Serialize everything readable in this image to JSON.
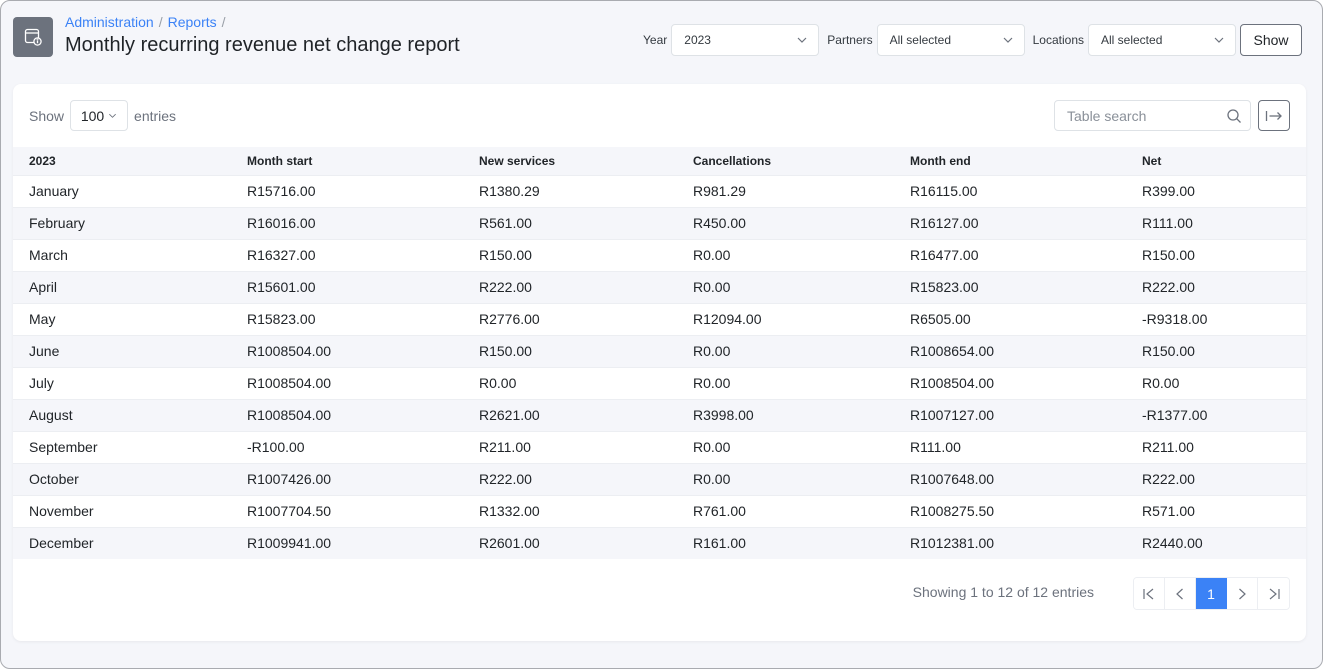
{
  "header": {
    "icon": "report-info-icon",
    "breadcrumb": [
      {
        "label": "Administration"
      },
      {
        "label": "Reports"
      }
    ],
    "separator": "/",
    "title": "Monthly recurring revenue net change report"
  },
  "filters": {
    "year": {
      "label": "Year",
      "value": "2023"
    },
    "partners": {
      "label": "Partners",
      "value": "All selected"
    },
    "locations": {
      "label": "Locations",
      "value": "All selected"
    },
    "show_button": "Show"
  },
  "table_controls": {
    "length_prefix": "Show",
    "length_value": "100",
    "length_suffix": "entries",
    "search_placeholder": "Table search",
    "export_icon": "export-arrow-icon"
  },
  "table": {
    "columns": [
      "2023",
      "Month start",
      "New services",
      "Cancellations",
      "Month end",
      "Net"
    ],
    "rows": [
      [
        "January",
        "R15716.00",
        "R1380.29",
        "R981.29",
        "R16115.00",
        "R399.00"
      ],
      [
        "February",
        "R16016.00",
        "R561.00",
        "R450.00",
        "R16127.00",
        "R111.00"
      ],
      [
        "March",
        "R16327.00",
        "R150.00",
        "R0.00",
        "R16477.00",
        "R150.00"
      ],
      [
        "April",
        "R15601.00",
        "R222.00",
        "R0.00",
        "R15823.00",
        "R222.00"
      ],
      [
        "May",
        "R15823.00",
        "R2776.00",
        "R12094.00",
        "R6505.00",
        "-R9318.00"
      ],
      [
        "June",
        "R1008504.00",
        "R150.00",
        "R0.00",
        "R1008654.00",
        "R150.00"
      ],
      [
        "July",
        "R1008504.00",
        "R0.00",
        "R0.00",
        "R1008504.00",
        "R0.00"
      ],
      [
        "August",
        "R1008504.00",
        "R2621.00",
        "R3998.00",
        "R1007127.00",
        "-R1377.00"
      ],
      [
        "September",
        "-R100.00",
        "R211.00",
        "R0.00",
        "R111.00",
        "R211.00"
      ],
      [
        "October",
        "R1007426.00",
        "R222.00",
        "R0.00",
        "R1007648.00",
        "R222.00"
      ],
      [
        "November",
        "R1007704.50",
        "R1332.00",
        "R761.00",
        "R1008275.50",
        "R571.00"
      ],
      [
        "December",
        "R1009941.00",
        "R2601.00",
        "R161.00",
        "R1012381.00",
        "R2440.00"
      ]
    ]
  },
  "footer": {
    "info": "Showing 1 to 12 of 12 entries",
    "pagination": {
      "first": "first-page-icon",
      "prev": "previous-page-icon",
      "current": "1",
      "next": "next-page-icon",
      "last": "last-page-icon"
    }
  },
  "colors": {
    "accent": "#3b82f6",
    "icon_bg": "#6c727d",
    "page_bg": "#f5f6fa"
  }
}
